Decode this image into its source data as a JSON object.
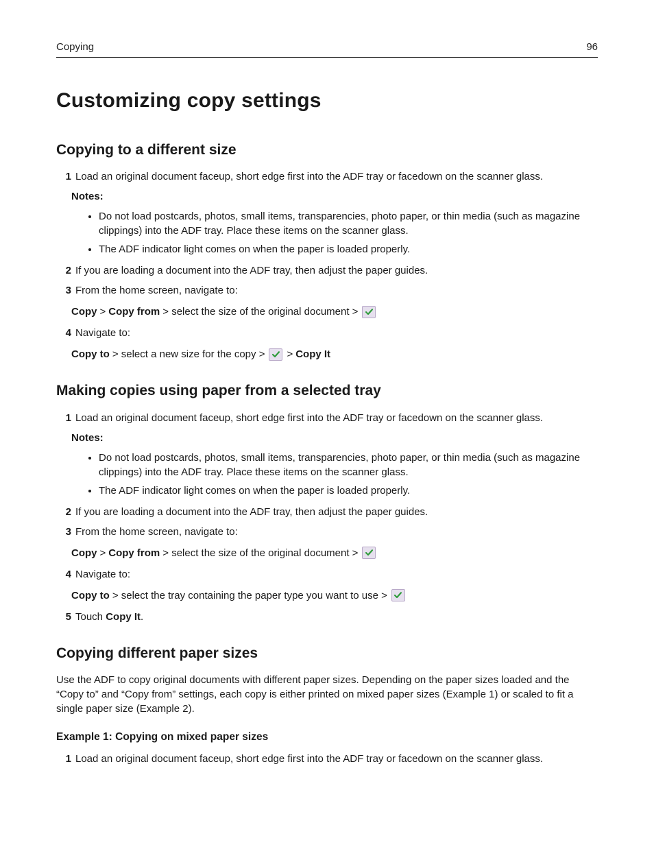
{
  "header": {
    "section": "Copying",
    "page_number": "96"
  },
  "title": "Customizing copy settings",
  "sectionA": {
    "heading": "Copying to a different size",
    "step1": "Load an original document faceup, short edge first into the ADF tray or facedown on the scanner glass.",
    "notes_label": "Notes:",
    "note1": "Do not load postcards, photos, small items, transparencies, photo paper, or thin media (such as magazine clippings) into the ADF tray. Place these items on the scanner glass.",
    "note2": "The ADF indicator light comes on when the paper is loaded properly.",
    "step2": "If you are loading a document into the ADF tray, then adjust the paper guides.",
    "step3": "From the home screen, navigate to:",
    "step3_path_a": "Copy",
    "step3_gt1": " > ",
    "step3_path_b": "Copy from",
    "step3_tail": " > select the size of the original document > ",
    "step4": "Navigate to:",
    "step4_path_a": "Copy to",
    "step4_tail1": " > select a new size for the copy > ",
    "step4_gt2": " > ",
    "step4_path_b": "Copy It"
  },
  "sectionB": {
    "heading": "Making copies using paper from a selected tray",
    "step1": "Load an original document faceup, short edge first into the ADF tray or facedown on the scanner glass.",
    "notes_label": "Notes:",
    "note1": "Do not load postcards, photos, small items, transparencies, photo paper, or thin media (such as magazine clippings) into the ADF tray. Place these items on the scanner glass.",
    "note2": "The ADF indicator light comes on when the paper is loaded properly.",
    "step2": "If you are loading a document into the ADF tray, then adjust the paper guides.",
    "step3": "From the home screen, navigate to:",
    "step3_path_a": "Copy",
    "step3_gt1": " > ",
    "step3_path_b": "Copy from",
    "step3_tail": " > select the size of the original document > ",
    "step4": "Navigate to:",
    "step4_path_a": "Copy to",
    "step4_tail": " > select the tray containing the paper type you want to use > ",
    "step5_pre": "Touch ",
    "step5_b": "Copy It",
    "step5_post": "."
  },
  "sectionC": {
    "heading": "Copying different paper sizes",
    "intro": "Use the ADF to copy original documents with different paper sizes. Depending on the paper sizes loaded and the “Copy to” and “Copy from” settings, each copy is either printed on mixed paper sizes (Example 1) or scaled to fit a single paper size (Example 2).",
    "example1_title": "Example 1: Copying on mixed paper sizes",
    "ex1_step1": "Load an original document faceup, short edge first into the ADF tray or facedown on the scanner glass."
  },
  "nums": {
    "n1": "1",
    "n2": "2",
    "n3": "3",
    "n4": "4",
    "n5": "5"
  }
}
